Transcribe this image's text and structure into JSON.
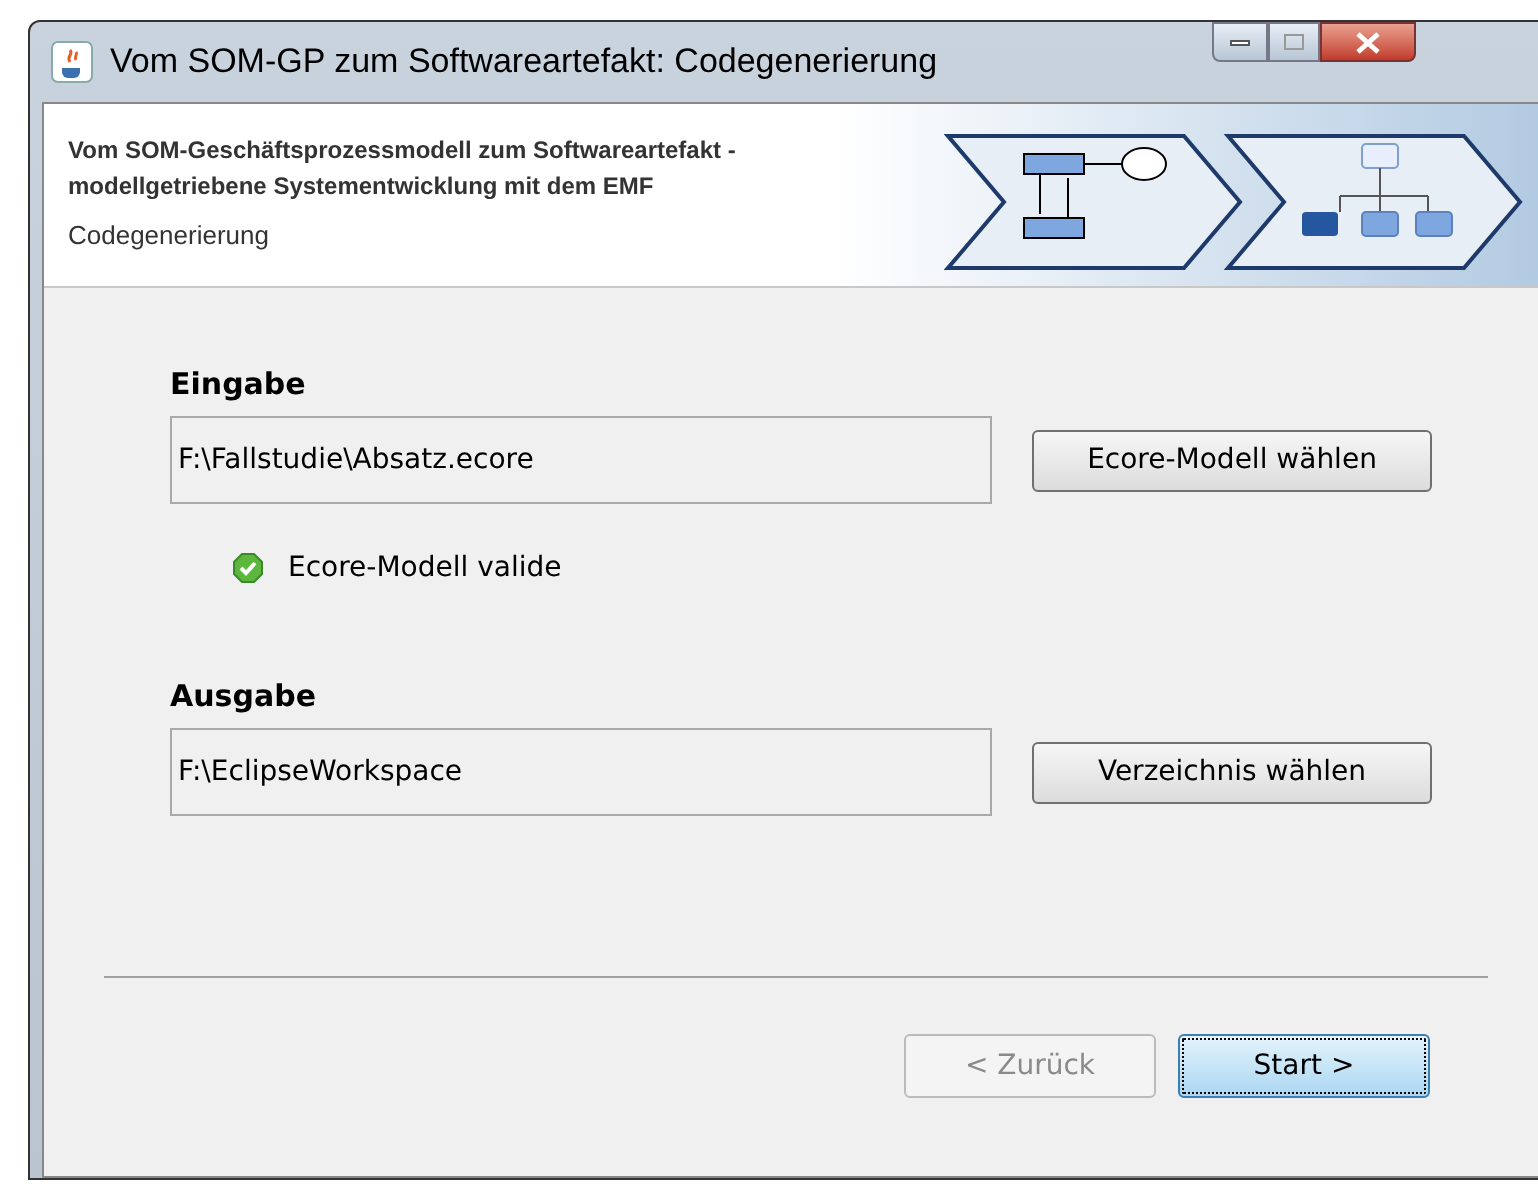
{
  "window": {
    "title": "Vom SOM-GP zum Softwareartefakt: Codegenerierung"
  },
  "header": {
    "title_lines": [
      "Vom SOM-Geschäftsprozessmodell zum Softwareartefakt -",
      "modellgetriebene Systementwicklung mit dem EMF"
    ],
    "subtitle": "Codegenerierung"
  },
  "input": {
    "label": "Eingabe",
    "value": "F:\\Fallstudie\\Absatz.ecore",
    "button": "Ecore-Modell wählen",
    "status": {
      "text": "Ecore-Modell valide",
      "valid": true
    }
  },
  "output": {
    "label": "Ausgabe",
    "value": "F:\\EclipseWorkspace",
    "button": "Verzeichnis wählen"
  },
  "buttons": [
    {
      "label": "< Zurück",
      "disabled": true,
      "focused": false
    },
    {
      "label": "Start >",
      "disabled": false,
      "focused": true
    }
  ]
}
